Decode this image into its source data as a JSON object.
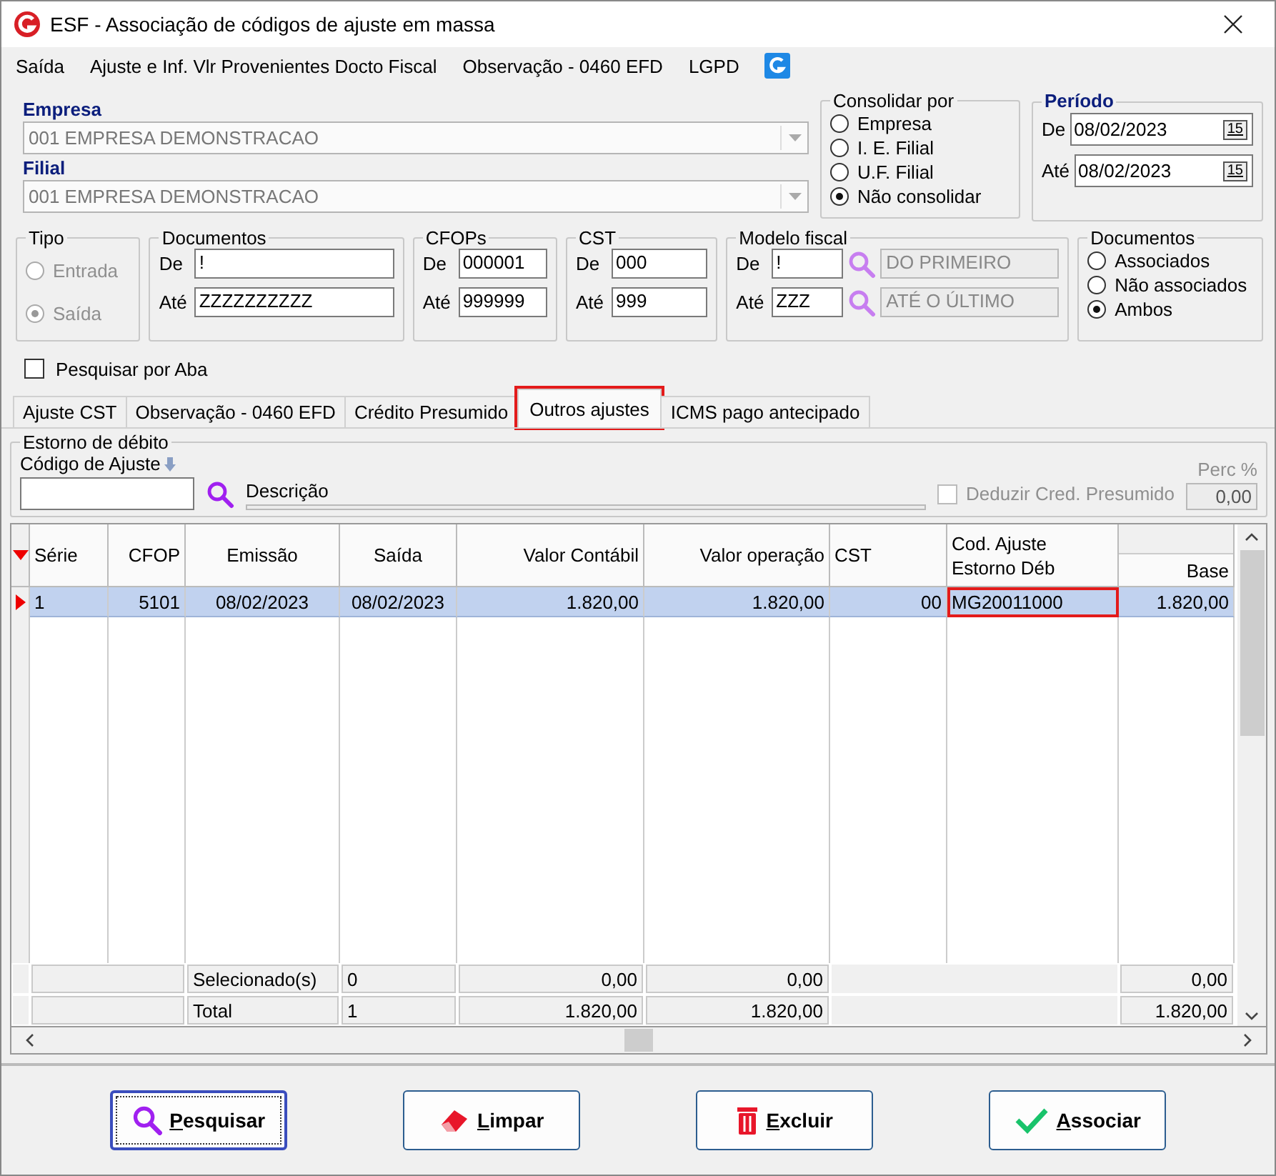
{
  "window": {
    "title": "ESF - Associação de códigos de ajuste em massa"
  },
  "menu": [
    "Saída",
    "Ajuste e Inf. Vlr Provenientes Docto Fiscal",
    "Observação - 0460 EFD",
    "LGPD"
  ],
  "empresa": {
    "label": "Empresa",
    "value": "001 EMPRESA DEMONSTRACAO"
  },
  "filial": {
    "label": "Filial",
    "value": "001 EMPRESA DEMONSTRACAO"
  },
  "consolidar_por": {
    "title": "Consolidar por",
    "options": [
      {
        "label": "Empresa",
        "selected": false
      },
      {
        "label": "I. E. Filial",
        "selected": false
      },
      {
        "label": "U.F. Filial",
        "selected": false
      },
      {
        "label": "Não consolidar",
        "selected": true
      }
    ]
  },
  "periodo": {
    "title": "Período",
    "de_label": "De",
    "de": "08/02/2023",
    "ate_label": "Até",
    "ate": "08/02/2023",
    "de_picker": "15",
    "ate_picker": "15"
  },
  "tipo": {
    "title": "Tipo",
    "disabled": true,
    "options": [
      {
        "label": "Entrada",
        "selected": false
      },
      {
        "label": "Saída",
        "selected": true
      }
    ]
  },
  "ranges": [
    {
      "title": "Documentos",
      "de_label": "De",
      "de": "!",
      "ate_label": "Até",
      "ate": "ZZZZZZZZZZ"
    },
    {
      "title": "CFOPs",
      "de_label": "De",
      "de": "000001",
      "ate_label": "Até",
      "ate": "999999"
    },
    {
      "title": "CST",
      "de_label": "De",
      "de": "000",
      "ate_label": "Até",
      "ate": "999"
    }
  ],
  "modelo_fiscal": {
    "title": "Modelo fiscal",
    "de_label": "De",
    "de": "!",
    "de_description": "DO PRIMEIRO",
    "ate_label": "Até",
    "ate": "ZZZ",
    "ate_description": "ATÉ O ÚLTIMO"
  },
  "documentos_filter": {
    "title": "Documentos",
    "options": [
      {
        "label": "Associados",
        "selected": false
      },
      {
        "label": "Não associados",
        "selected": false
      },
      {
        "label": "Ambos",
        "selected": true
      }
    ]
  },
  "pesquisar_por_aba": {
    "label": "Pesquisar por Aba",
    "checked": false
  },
  "tabs": [
    {
      "label": "Ajuste CST",
      "selected": false,
      "highlighted": false
    },
    {
      "label": "Observação - 0460 EFD",
      "selected": false,
      "highlighted": false
    },
    {
      "label": "Crédito Presumido",
      "selected": false,
      "highlighted": false
    },
    {
      "label": "Outros ajustes",
      "selected": true,
      "highlighted": true
    },
    {
      "label": "ICMS pago antecipado",
      "selected": false,
      "highlighted": false
    }
  ],
  "estorno": {
    "title": "Estorno de débito",
    "codigo_label": "Código de Ajuste",
    "descricao_label": "Descrição",
    "deduzir": {
      "label": "Deduzir Cred. Presumido",
      "checked": false,
      "disabled": true
    },
    "perc_label": "Perc %",
    "perc_value": "0,00"
  },
  "table": {
    "columns": [
      "Série",
      "CFOP",
      "Emissão",
      "Saída",
      "Valor Contábil",
      "Valor operação",
      "CST",
      "Cod. Ajuste\nEstorno Déb",
      "Base"
    ],
    "rows": [
      {
        "selected": true,
        "cells": [
          {
            "text": "1",
            "highlighted": false
          },
          {
            "text": "5101",
            "highlighted": false
          },
          {
            "text": "08/02/2023",
            "highlighted": false
          },
          {
            "text": "08/02/2023",
            "highlighted": false
          },
          {
            "text": "1.820,00",
            "highlighted": false
          },
          {
            "text": "1.820,00",
            "highlighted": false
          },
          {
            "text": "00",
            "highlighted": false
          },
          {
            "text": "MG20011000",
            "highlighted": true
          },
          {
            "text": "1.820,00",
            "highlighted": false
          }
        ]
      }
    ],
    "footer": [
      {
        "label": "Selecionado(s)",
        "count": "0",
        "valor_contabil": "0,00",
        "valor_operacao": "0,00",
        "base": "0,00"
      },
      {
        "label": "Total",
        "count": "1",
        "valor_contabil": "1.820,00",
        "valor_operacao": "1.820,00",
        "base": "1.820,00"
      }
    ]
  },
  "buttons": [
    {
      "label": "Pesquisar",
      "kind": "search",
      "focused": true
    },
    {
      "label": "Limpar",
      "kind": "clear",
      "focused": false
    },
    {
      "label": "Excluir",
      "kind": "delete",
      "focused": false
    },
    {
      "label": "Associar",
      "kind": "associate",
      "focused": false
    }
  ]
}
